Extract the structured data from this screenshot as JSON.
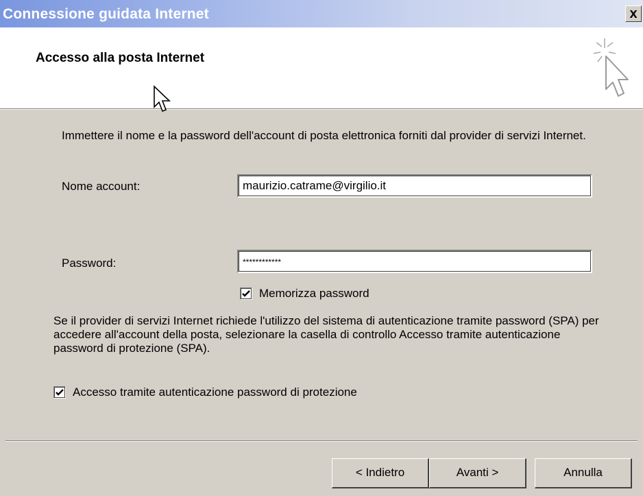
{
  "window": {
    "title": "Connessione guidata Internet",
    "close_label": "x"
  },
  "header": {
    "title": "Accesso alla posta Internet"
  },
  "form": {
    "intro": "Immettere il nome e la password dell'account di posta elettronica forniti dal provider di servizi Internet.",
    "account_label": "Nome account:",
    "account_value": "maurizio.catrame@virgilio.it",
    "password_label": "Password:",
    "password_value": "************",
    "remember_label": "Memorizza password",
    "remember_checked": true,
    "spa_text": "Se il provider di servizi Internet richiede l'utilizzo del sistema di autenticazione tramite password (SPA) per accedere all'account della posta, selezionare la casella di controllo Accesso tramite autenticazione password di protezione (SPA).",
    "spa_label": "Accesso tramite autenticazione password di protezione",
    "spa_checked": true
  },
  "buttons": {
    "back": "< Indietro",
    "next": "Avanti >",
    "cancel": "Annulla"
  },
  "icons": {
    "wizard": "wizard-sparkle-cursor-icon",
    "pointer": "mouse-pointer-icon"
  }
}
